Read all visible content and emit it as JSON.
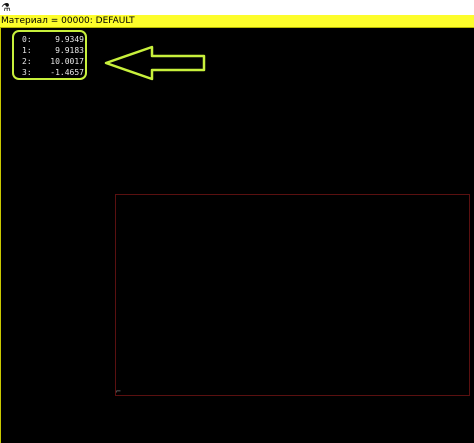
{
  "window": {
    "app_icon": "app-icon",
    "title": "Материал = 00000: DEFAULT"
  },
  "readout": {
    "rows": [
      {
        "index": "0:",
        "value": "9.9349"
      },
      {
        "index": "1:",
        "value": "9.9183"
      },
      {
        "index": "2:",
        "value": "10.0017"
      },
      {
        "index": "3:",
        "value": "-1.4657"
      }
    ]
  },
  "annotation": {
    "arrow_icon": "arrow-left-icon",
    "highlight_color": "#c8f03c"
  },
  "colors": {
    "titlebar": "#fdfd2b",
    "background": "#000000",
    "frame": "#5a1010"
  }
}
